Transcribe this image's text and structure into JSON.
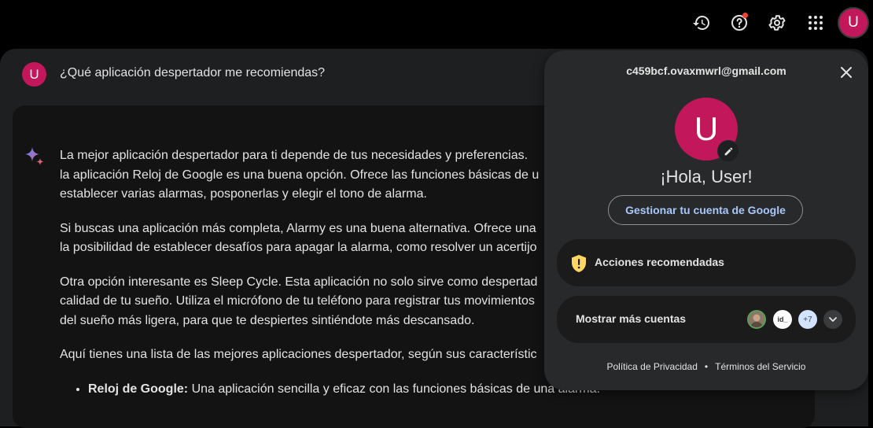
{
  "topbar": {
    "icons": [
      "history-icon",
      "help-icon",
      "settings-icon",
      "apps-grid-icon"
    ],
    "avatar_letter": "U",
    "avatar_color": "#c2185b"
  },
  "conversation": {
    "query_avatar_letter": "U",
    "query": "¿Qué aplicación despertador me recomiendas?",
    "response": {
      "p1": [
        "La mejor aplicación despertador para ti depende de tus necesidades y preferencias.",
        "la aplicación Reloj de Google es una buena opción. Ofrece las funciones básicas de u",
        "establecer varias alarmas, posponerlas y elegir el tono de alarma."
      ],
      "p2": [
        "Si buscas una aplicación más completa, Alarmy es una buena alternativa. Ofrece una",
        "la posibilidad de establecer desafíos para apagar la alarma, como resolver un acertijo"
      ],
      "p3": [
        "Otra opción interesante es Sleep Cycle. Esta aplicación no solo sirve como despertad",
        "calidad de tu sueño. Utiliza el micrófono de tu teléfono para registrar tus movimientos",
        "del sueño más ligera, para que te despiertes sintiéndote más descansado."
      ],
      "p4": "Aquí tienes una lista de las mejores aplicaciones despertador, según sus característic",
      "bullet1_bold": "Reloj de Google:",
      "bullet1_text": " Una aplicación sencilla y eficaz con las funciones básicas de una alarma."
    }
  },
  "account_popup": {
    "email": "c459bcf.ovaxmwrl@gmail.com",
    "avatar_letter": "U",
    "greeting": "¡Hola, User!",
    "manage_button": "Gestionar tu cuenta de Google",
    "recommended_actions": "Acciones recomendadas",
    "more_accounts": "Mostrar más cuentas",
    "account_chip_id": "id_",
    "account_chip_more": "+7",
    "privacy_link": "Política de Privacidad",
    "separator": "•",
    "terms_link": "Términos del Servicio"
  }
}
